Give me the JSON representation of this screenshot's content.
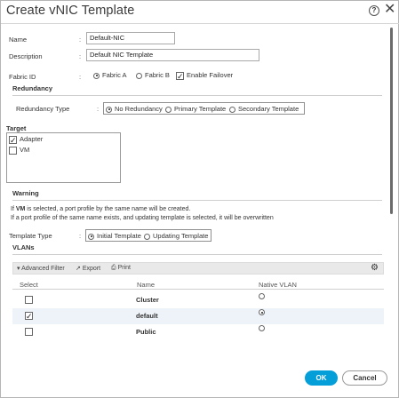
{
  "dialog": {
    "title": "Create vNIC Template",
    "help": "?",
    "close": "✕"
  },
  "form": {
    "name_label": "Name",
    "name_value": "Default-NIC",
    "description_label": "Description",
    "description_value": "Default NIC Template",
    "fabric_label": "Fabric ID",
    "fabric_a": "Fabric A",
    "fabric_b": "Fabric B",
    "failover": "Enable Failover",
    "colon": ":"
  },
  "redundancy": {
    "section": "Redundancy",
    "type_label": "Redundancy Type",
    "options": [
      "No Redundancy",
      "Primary Template",
      "Secondary Template"
    ],
    "selected": "No Redundancy"
  },
  "target": {
    "section": "Target",
    "items": [
      {
        "label": "Adapter",
        "checked": true
      },
      {
        "label": "VM",
        "checked": false
      }
    ]
  },
  "warning": {
    "section": "Warning",
    "line1_prefix": "If ",
    "line1_bold": "VM",
    "line1_suffix": " is selected, a port profile by the same name will be created.",
    "line2": "If a port profile of the same name exists, and updating template is selected, it will be overwritten"
  },
  "template_type": {
    "label": "Template Type",
    "options": [
      "Initial Template",
      "Updating Template"
    ],
    "selected": "Initial Template"
  },
  "vlans": {
    "section": "VLANs",
    "toolbar": {
      "filter": "Advanced Filter",
      "export": "Export",
      "print": "Print"
    },
    "columns": [
      "Select",
      "Name",
      "Native VLAN"
    ],
    "rows": [
      {
        "name": "Cluster",
        "selected": false,
        "native": false
      },
      {
        "name": "default",
        "selected": true,
        "native": true
      },
      {
        "name": "Public",
        "selected": false,
        "native": false
      }
    ]
  },
  "buttons": {
    "ok": "OK",
    "cancel": "Cancel"
  },
  "colors": {
    "accent": "#049fd9",
    "row_highlight": "#eef3f9"
  }
}
